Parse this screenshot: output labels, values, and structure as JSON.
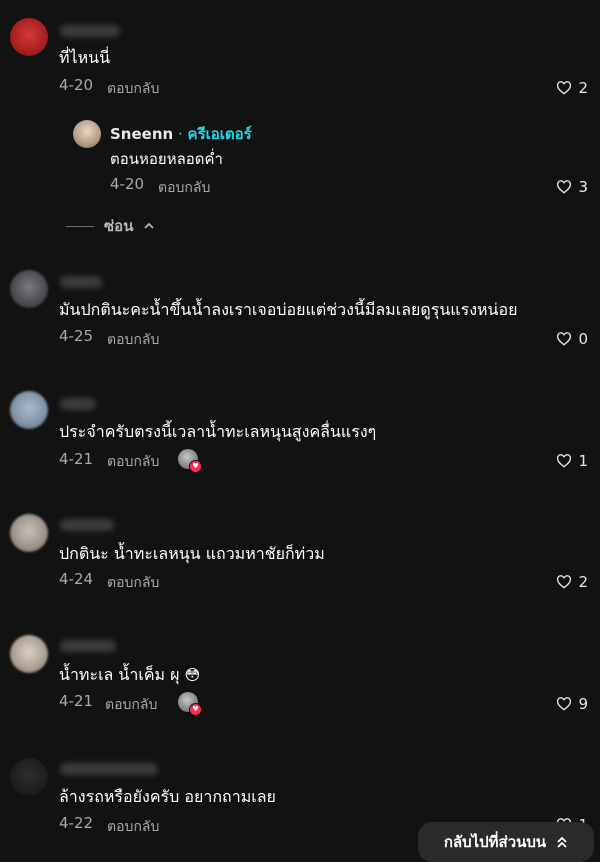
{
  "comments": [
    {
      "text": "ที่ไหนนี่",
      "date": "4-20",
      "reply_label": "ตอบกลับ",
      "likes": "2"
    },
    {
      "text": "มันปกตินะคะน้ำขึ้นน้ำลงเราเจอบ่อยแต่ช่วงนี้มีลมเลยดูรุนแรงหน่อย",
      "date": "4-25",
      "reply_label": "ตอบกลับ",
      "likes": "0"
    },
    {
      "text": "ประจำครับตรงนี้เวลาน้ำทะเลหนุนสูงคลื่นแรงๆ",
      "date": "4-21",
      "reply_label": "ตอบกลับ",
      "likes": "1"
    },
    {
      "text": "ปกตินะ น้ำทะเลหนุน แถวมหาชัยก็ท่วม",
      "date": "4-24",
      "reply_label": "ตอบกลับ",
      "likes": "2"
    },
    {
      "text": "น้ำทะเล น้ำเค็ม ผุ",
      "date": "4-21",
      "reply_label": "ตอบกลับ",
      "likes": "9"
    },
    {
      "text": "ล้างรถหรือยังครับ อยากถามเลย",
      "date": "4-22",
      "reply_label": "ตอบกลับ",
      "likes": "1"
    }
  ],
  "creator_reply": {
    "username": "Sneenn",
    "separator": "·",
    "badge": "ครีเอเตอร์",
    "text": "ตอนหอยหลอดค่ำ",
    "date": "4-20",
    "reply_label": "ตอบกลับ",
    "likes": "3"
  },
  "hide_replies_label": "ซ่อน",
  "emoji_face": "😳",
  "back_to_top_label": "กลับไปที่ส่วนบน",
  "colors": {
    "background": "#121212",
    "creator_badge": "#20d5ec",
    "liked_heart": "#fe2c55",
    "muted_text": "#a8a8a8"
  },
  "icons": {
    "like": "heart-outline-icon",
    "collapse": "chevron-up-icon",
    "back_to_top": "double-chevron-up-icon"
  }
}
